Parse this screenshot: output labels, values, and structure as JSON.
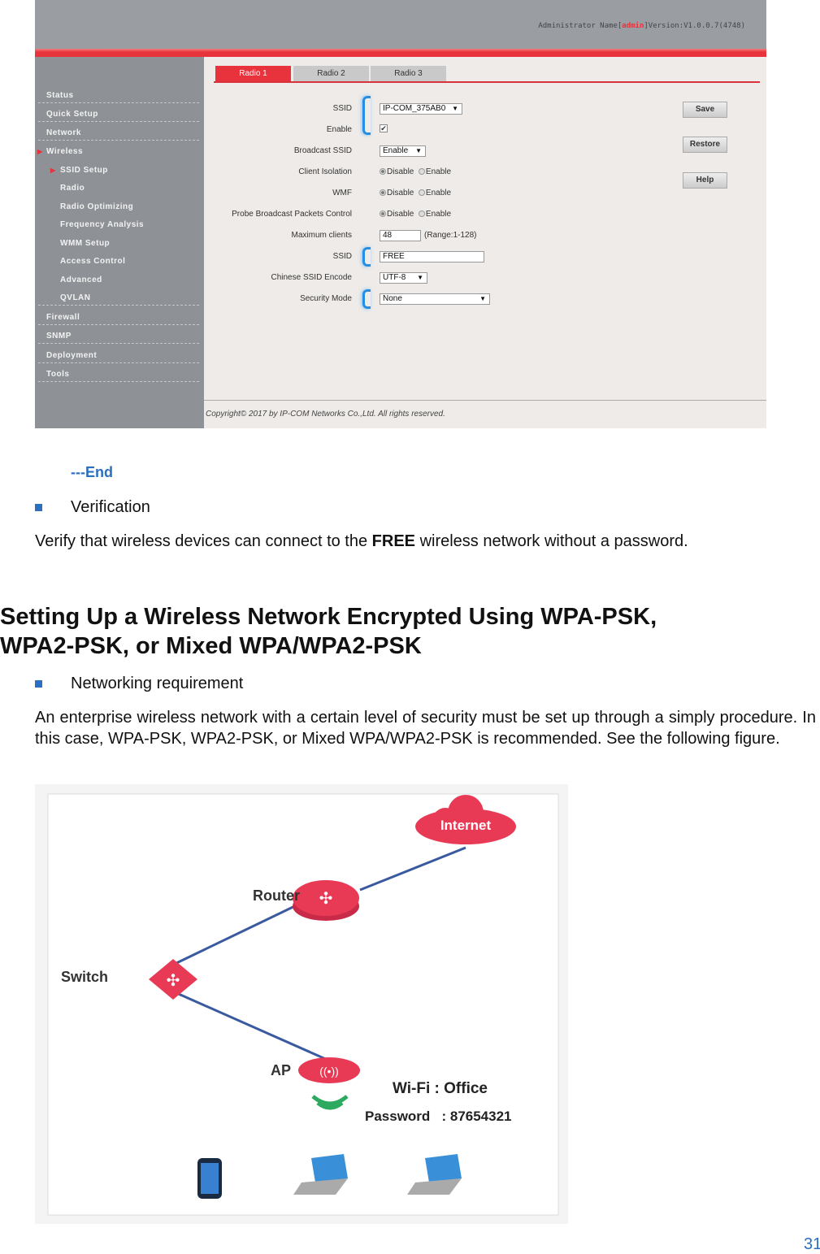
{
  "screenshot": {
    "header": {
      "admin_prefix": "Administrator Name[",
      "admin_name": "admin",
      "version": "]Version:V1.0.0.7(4748)"
    },
    "sidebar": [
      "Status",
      "Quick Setup",
      "Network",
      "Wireless",
      "SSID Setup",
      "Radio",
      "Radio Optimizing",
      "Frequency Analysis",
      "WMM Setup",
      "Access Control",
      "Advanced",
      "QVLAN",
      "Firewall",
      "SNMP",
      "Deployment",
      "Tools"
    ],
    "tabs": [
      "Radio 1",
      "Radio 2",
      "Radio 3"
    ],
    "form": {
      "ssid_label": "SSID",
      "ssid_value": "IP-COM_375AB0",
      "enable_label": "Enable",
      "broadcast_label": "Broadcast SSID",
      "broadcast_value": "Enable",
      "isolation_label": "Client Isolation",
      "wmf_label": "WMF",
      "probe_label": "Probe Broadcast Packets Control",
      "disable": "Disable",
      "enable": "Enable",
      "max_label": "Maximum clients",
      "max_value": "48",
      "max_range": "(Range:1-128)",
      "ssid2_label": "SSID",
      "ssid2_value": "FREE",
      "encode_label": "Chinese SSID Encode",
      "encode_value": "UTF-8",
      "security_label": "Security Mode",
      "security_value": "None"
    },
    "buttons": {
      "save": "Save",
      "restore": "Restore",
      "help": "Help"
    },
    "copyright": "Copyright© 2017 by IP-COM Networks Co.,Ltd. All rights reserved."
  },
  "doc": {
    "end": "---End",
    "verification": "Verification",
    "verify_pre": "Verify that wireless devices can connect to the ",
    "verify_bold": "FREE",
    "verify_post": " wireless network without a password.",
    "heading1": "Setting Up a Wireless Network Encrypted Using WPA-PSK,",
    "heading2": "WPA2-PSK, or Mixed WPA/WPA2-PSK",
    "req": "Networking requirement",
    "para": "An enterprise wireless network with a certain level of security must be set up through a simply procedure. In this case, WPA-PSK, WPA2-PSK, or Mixed WPA/WPA2-PSK is recommended. See the following figure.",
    "page_number": "31"
  },
  "diagram": {
    "internet": "Internet",
    "router": "Router",
    "switch": "Switch",
    "ap": "AP",
    "wifi": "Wi-Fi : Office",
    "password": "Password   : 87654321"
  },
  "colors": {
    "accent": "#e8323c",
    "link": "#2a6fc0"
  }
}
